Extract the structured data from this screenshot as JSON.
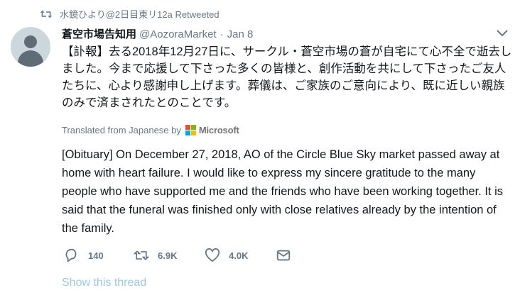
{
  "retweet": {
    "icon": "retweet-icon",
    "text": "水鏡ひより@2日目東リ12a Retweeted"
  },
  "tweet": {
    "avatar": "default-profile-avatar",
    "display_name": "蒼空市場告知用",
    "handle": "@AozoraMarket",
    "separator": "·",
    "date": "Jan 8",
    "text": "【訃報】去る2018年12月27日に、サークル・蒼空市場の蒼が自宅にて心不全で逝去しました。今まで応援して下さった多くの皆様と、創作活動を共にして下さったご友人たちに、心より感謝申し上げます。葬儀は、ご家族のご意向により、既に近しい親族のみで済まされたとのことです。",
    "translated_label": "Translated from Japanese by",
    "translator_name": "Microsoft",
    "translation": "[Obituary] On December 27, 2018, AO of the Circle Blue Sky market passed away at home with heart failure. I would like to express my sincere gratitude to the many people who have supported me and the friends who have been working together. It is said that the funeral was finished only with close relatives already by the intention of the family."
  },
  "actions": {
    "reply_count": "140",
    "retweet_count": "6.9K",
    "like_count": "4.0K"
  },
  "show_thread": "Show this thread",
  "colors": {
    "text": "#14171a",
    "secondary": "#657786",
    "link_faded": "#9fc6ea",
    "avatar_bg": "#ccd6dd"
  }
}
